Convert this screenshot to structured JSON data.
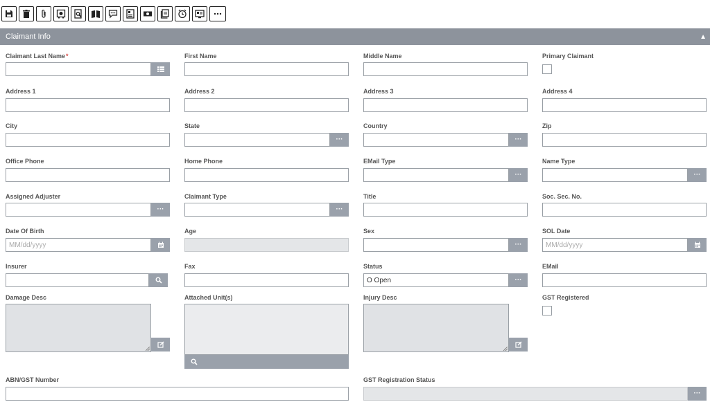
{
  "toolbar": {
    "buttons": [
      "save-icon",
      "trash-icon",
      "paperclip-icon",
      "safe-icon",
      "document-search-icon",
      "book-icon",
      "comment-icon",
      "id-card-icon",
      "money-icon",
      "notes-icon",
      "clock-icon",
      "screen-icon",
      "more-icon"
    ]
  },
  "section": {
    "title": "Claimant Info"
  },
  "labels": {
    "claimant_last_name": "Claimant Last Name",
    "required_mark": "*",
    "first_name": "First Name",
    "middle_name": "Middle Name",
    "primary_claimant": "Primary Claimant",
    "address1": "Address 1",
    "address2": "Address 2",
    "address3": "Address 3",
    "address4": "Address 4",
    "city": "City",
    "state": "State",
    "country": "Country",
    "zip": "Zip",
    "office_phone": "Office Phone",
    "home_phone": "Home Phone",
    "email_type": "EMail Type",
    "name_type": "Name Type",
    "assigned_adjuster": "Assigned Adjuster",
    "claimant_type": "Claimant Type",
    "title": "Title",
    "ssn": "Soc. Sec. No.",
    "dob": "Date Of Birth",
    "age": "Age",
    "sex": "Sex",
    "sol_date": "SOL Date",
    "insurer": "Insurer",
    "fax": "Fax",
    "status": "Status",
    "email": "EMail",
    "damage_desc": "Damage Desc",
    "attached_units": "Attached Unit(s)",
    "injury_desc": "Injury Desc",
    "gst_registered": "GST Registered",
    "abn_gst": "ABN/GST Number",
    "gst_status": "GST Registration Status"
  },
  "values": {
    "status": "O Open"
  },
  "placeholders": {
    "date": "MM/dd/yyyy"
  },
  "colors": {
    "header_bg": "#8d939c",
    "addon_bg": "#9aa1ab",
    "required": "#d9534f"
  }
}
